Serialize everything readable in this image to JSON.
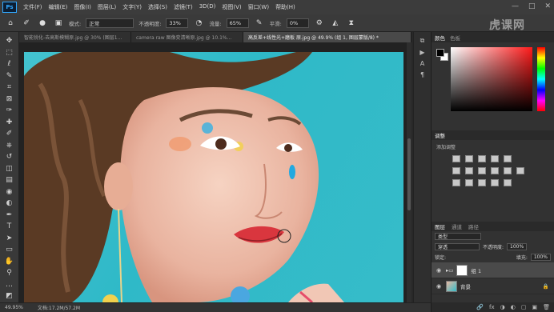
{
  "app": {
    "logo": "Ps"
  },
  "menu": [
    "文件(F)",
    "编辑(E)",
    "图像(I)",
    "图层(L)",
    "文字(Y)",
    "选择(S)",
    "滤镜(T)",
    "3D(D)",
    "视图(V)",
    "窗口(W)",
    "帮助(H)"
  ],
  "window_controls": [
    "—",
    "□",
    "✕"
  ],
  "options": {
    "mode_label": "模式:",
    "mode_value": "正常",
    "opacity_label": "不透明度:",
    "opacity_value": "33%",
    "flow_label": "流量:",
    "flow_value": "65%",
    "smooth_label": "平滑:",
    "smooth_value": "0%"
  },
  "watermark": "虎课网",
  "tabs": [
    "智能锐化-去高斯模糊原.jpg @ 30% (图层1...",
    "camera raw 图像变清晰原.jpg @ 10.1%...",
    "高反差+线性光+磨板 原.jpg @ 49.9% (组 1, 图层蒙版/8) *"
  ],
  "tools": [
    "move-icon",
    "marquee-icon",
    "lasso-icon",
    "quick-select-icon",
    "crop-icon",
    "frame-icon",
    "eyedropper-icon",
    "healing-icon",
    "brush-icon",
    "stamp-icon",
    "history-brush-icon",
    "eraser-icon",
    "gradient-icon",
    "blur-icon",
    "dodge-icon",
    "pen-icon",
    "type-icon",
    "path-select-icon",
    "rectangle-icon",
    "hand-icon",
    "zoom-icon",
    "more-icon",
    "swap-color-icon"
  ],
  "tool_glyphs": [
    "✥",
    "⬚",
    "ℓ",
    "✎",
    "⌗",
    "⊠",
    "✑",
    "✚",
    "✐",
    "⎈",
    "↺",
    "◫",
    "▤",
    "◉",
    "◐",
    "✒",
    "T",
    "➤",
    "▭",
    "✋",
    "⚲",
    "…",
    "◩"
  ],
  "status": {
    "zoom": "49.95%",
    "doc": "文档:17.2M/57.2M"
  },
  "panels": {
    "color_tabs": [
      "颜色",
      "色板"
    ],
    "adjust_title": "调整",
    "adjust_label": "添加调整",
    "layer_tabs": [
      "图层",
      "通道",
      "路径"
    ],
    "kind_label": "类型",
    "blend_value": "穿透",
    "opacity_label": "不透明度:",
    "opacity_value": "100%",
    "lock_label": "锁定:",
    "fill_label": "填充:",
    "fill_value": "100%",
    "layers": [
      {
        "name": "组 1",
        "selected": true
      },
      {
        "name": "背景",
        "selected": false
      }
    ],
    "footer_icons": [
      "🔗",
      "fx",
      "◑",
      "◐",
      "▢",
      "▣",
      "🗑"
    ]
  },
  "colors": {
    "accent": "#31a8ff",
    "canvas_bg": "#36bcc9"
  }
}
